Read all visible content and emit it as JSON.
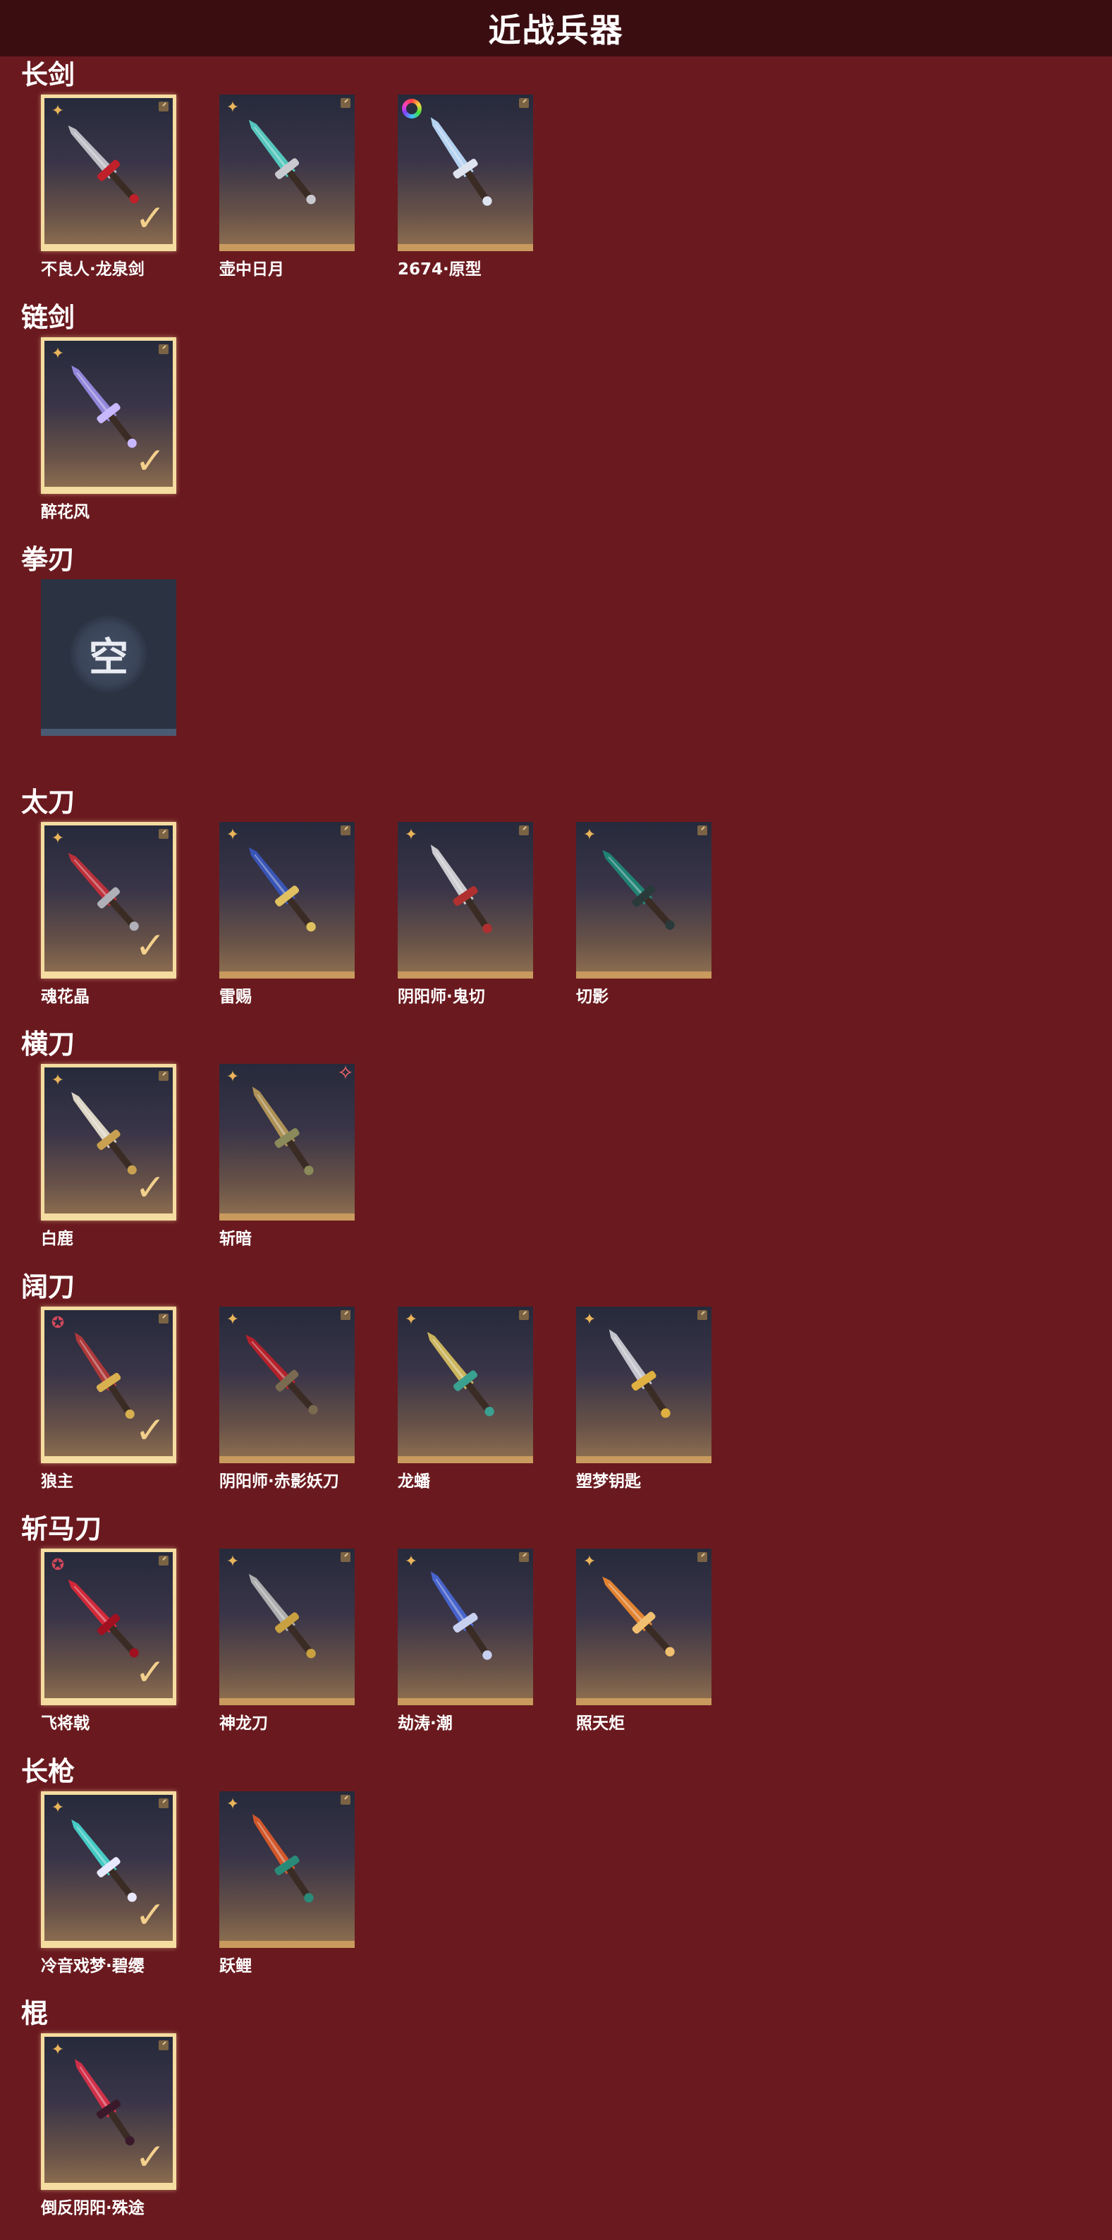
{
  "page": {
    "title": "近战兵器"
  },
  "empty_label": "空",
  "colors": {
    "background": "#6a1a1f",
    "header": "#3a0d11",
    "check": "#f3d08c",
    "gold_badge": "#e9b45a"
  },
  "sections": [
    {
      "title": "长剑",
      "items": [
        {
          "name": "不良人·龙泉剑",
          "badge": "gold",
          "selected": true,
          "blade": "#c9c9d0",
          "accent": "#c0202a"
        },
        {
          "name": "壶中日月",
          "badge": "gold",
          "selected": false,
          "blade": "#58d4c8",
          "accent": "#c9c9d0"
        },
        {
          "name": "2674·原型",
          "badge": "rainbow",
          "selected": false,
          "blade": "#bfe0ff",
          "accent": "#dde4f0"
        }
      ]
    },
    {
      "title": "链剑",
      "items": [
        {
          "name": "醉花风",
          "badge": "gold",
          "selected": true,
          "blade": "#9a8ee8",
          "accent": "#c8b8ff"
        }
      ]
    },
    {
      "title": "拳刃",
      "items": [
        {
          "name": "",
          "empty": true
        }
      ]
    },
    {
      "title": "太刀",
      "items": [
        {
          "name": "魂花晶",
          "badge": "gold",
          "selected": true,
          "blade": "#c8303a",
          "accent": "#b0b0b8"
        },
        {
          "name": "雷赐",
          "badge": "gold",
          "selected": false,
          "blade": "#3a58c0",
          "accent": "#e0c060"
        },
        {
          "name": "阴阳师·鬼切",
          "badge": "gold",
          "selected": false,
          "blade": "#d8d8dc",
          "accent": "#b03030"
        },
        {
          "name": "切影",
          "badge": "gold",
          "selected": false,
          "blade": "#1e8a78",
          "accent": "#2a3a3a"
        }
      ]
    },
    {
      "title": "横刀",
      "items": [
        {
          "name": "白鹿",
          "badge": "gold",
          "selected": true,
          "blade": "#ece4d0",
          "accent": "#c8a050"
        },
        {
          "name": "斩暗",
          "badge": "gold",
          "selected": false,
          "corner": "red",
          "blade": "#b89a58",
          "accent": "#8a8a5a"
        }
      ]
    },
    {
      "title": "阔刀",
      "items": [
        {
          "name": "狼主",
          "badge": "red",
          "selected": true,
          "blade": "#b83a3a",
          "accent": "#d8b050"
        },
        {
          "name": "阴阳师·赤影妖刀",
          "badge": "gold",
          "selected": false,
          "blade": "#c02028",
          "accent": "#7a6a50"
        },
        {
          "name": "龙蟠",
          "badge": "gold",
          "selected": false,
          "blade": "#d8c060",
          "accent": "#3aa090"
        },
        {
          "name": "塑梦钥匙",
          "badge": "gold",
          "selected": false,
          "blade": "#d0d0d8",
          "accent": "#e0b040"
        }
      ]
    },
    {
      "title": "斩马刀",
      "items": [
        {
          "name": "飞将戟",
          "badge": "red",
          "selected": true,
          "blade": "#e02838",
          "accent": "#a01020"
        },
        {
          "name": "神龙刀",
          "badge": "gold",
          "selected": false,
          "blade": "#b8b8b8",
          "accent": "#c8a040"
        },
        {
          "name": "劫涛·潮",
          "badge": "gold",
          "selected": false,
          "blade": "#4a68d8",
          "accent": "#c8d0f0"
        },
        {
          "name": "照天炬",
          "badge": "gold",
          "selected": false,
          "blade": "#f08a30",
          "accent": "#f0c070"
        }
      ]
    },
    {
      "title": "长枪",
      "items": [
        {
          "name": "冷音戏梦·碧缨",
          "badge": "gold",
          "selected": true,
          "blade": "#48d8d0",
          "accent": "#e8e8ff"
        },
        {
          "name": "跃鲤",
          "badge": "gold",
          "selected": false,
          "blade": "#e05a28",
          "accent": "#2a8a78"
        }
      ]
    },
    {
      "title": "棍",
      "items": [
        {
          "name": "倒反阴阳·殊途",
          "badge": "gold",
          "selected": true,
          "blade": "#e0304a",
          "accent": "#3a1a2a"
        }
      ]
    }
  ]
}
